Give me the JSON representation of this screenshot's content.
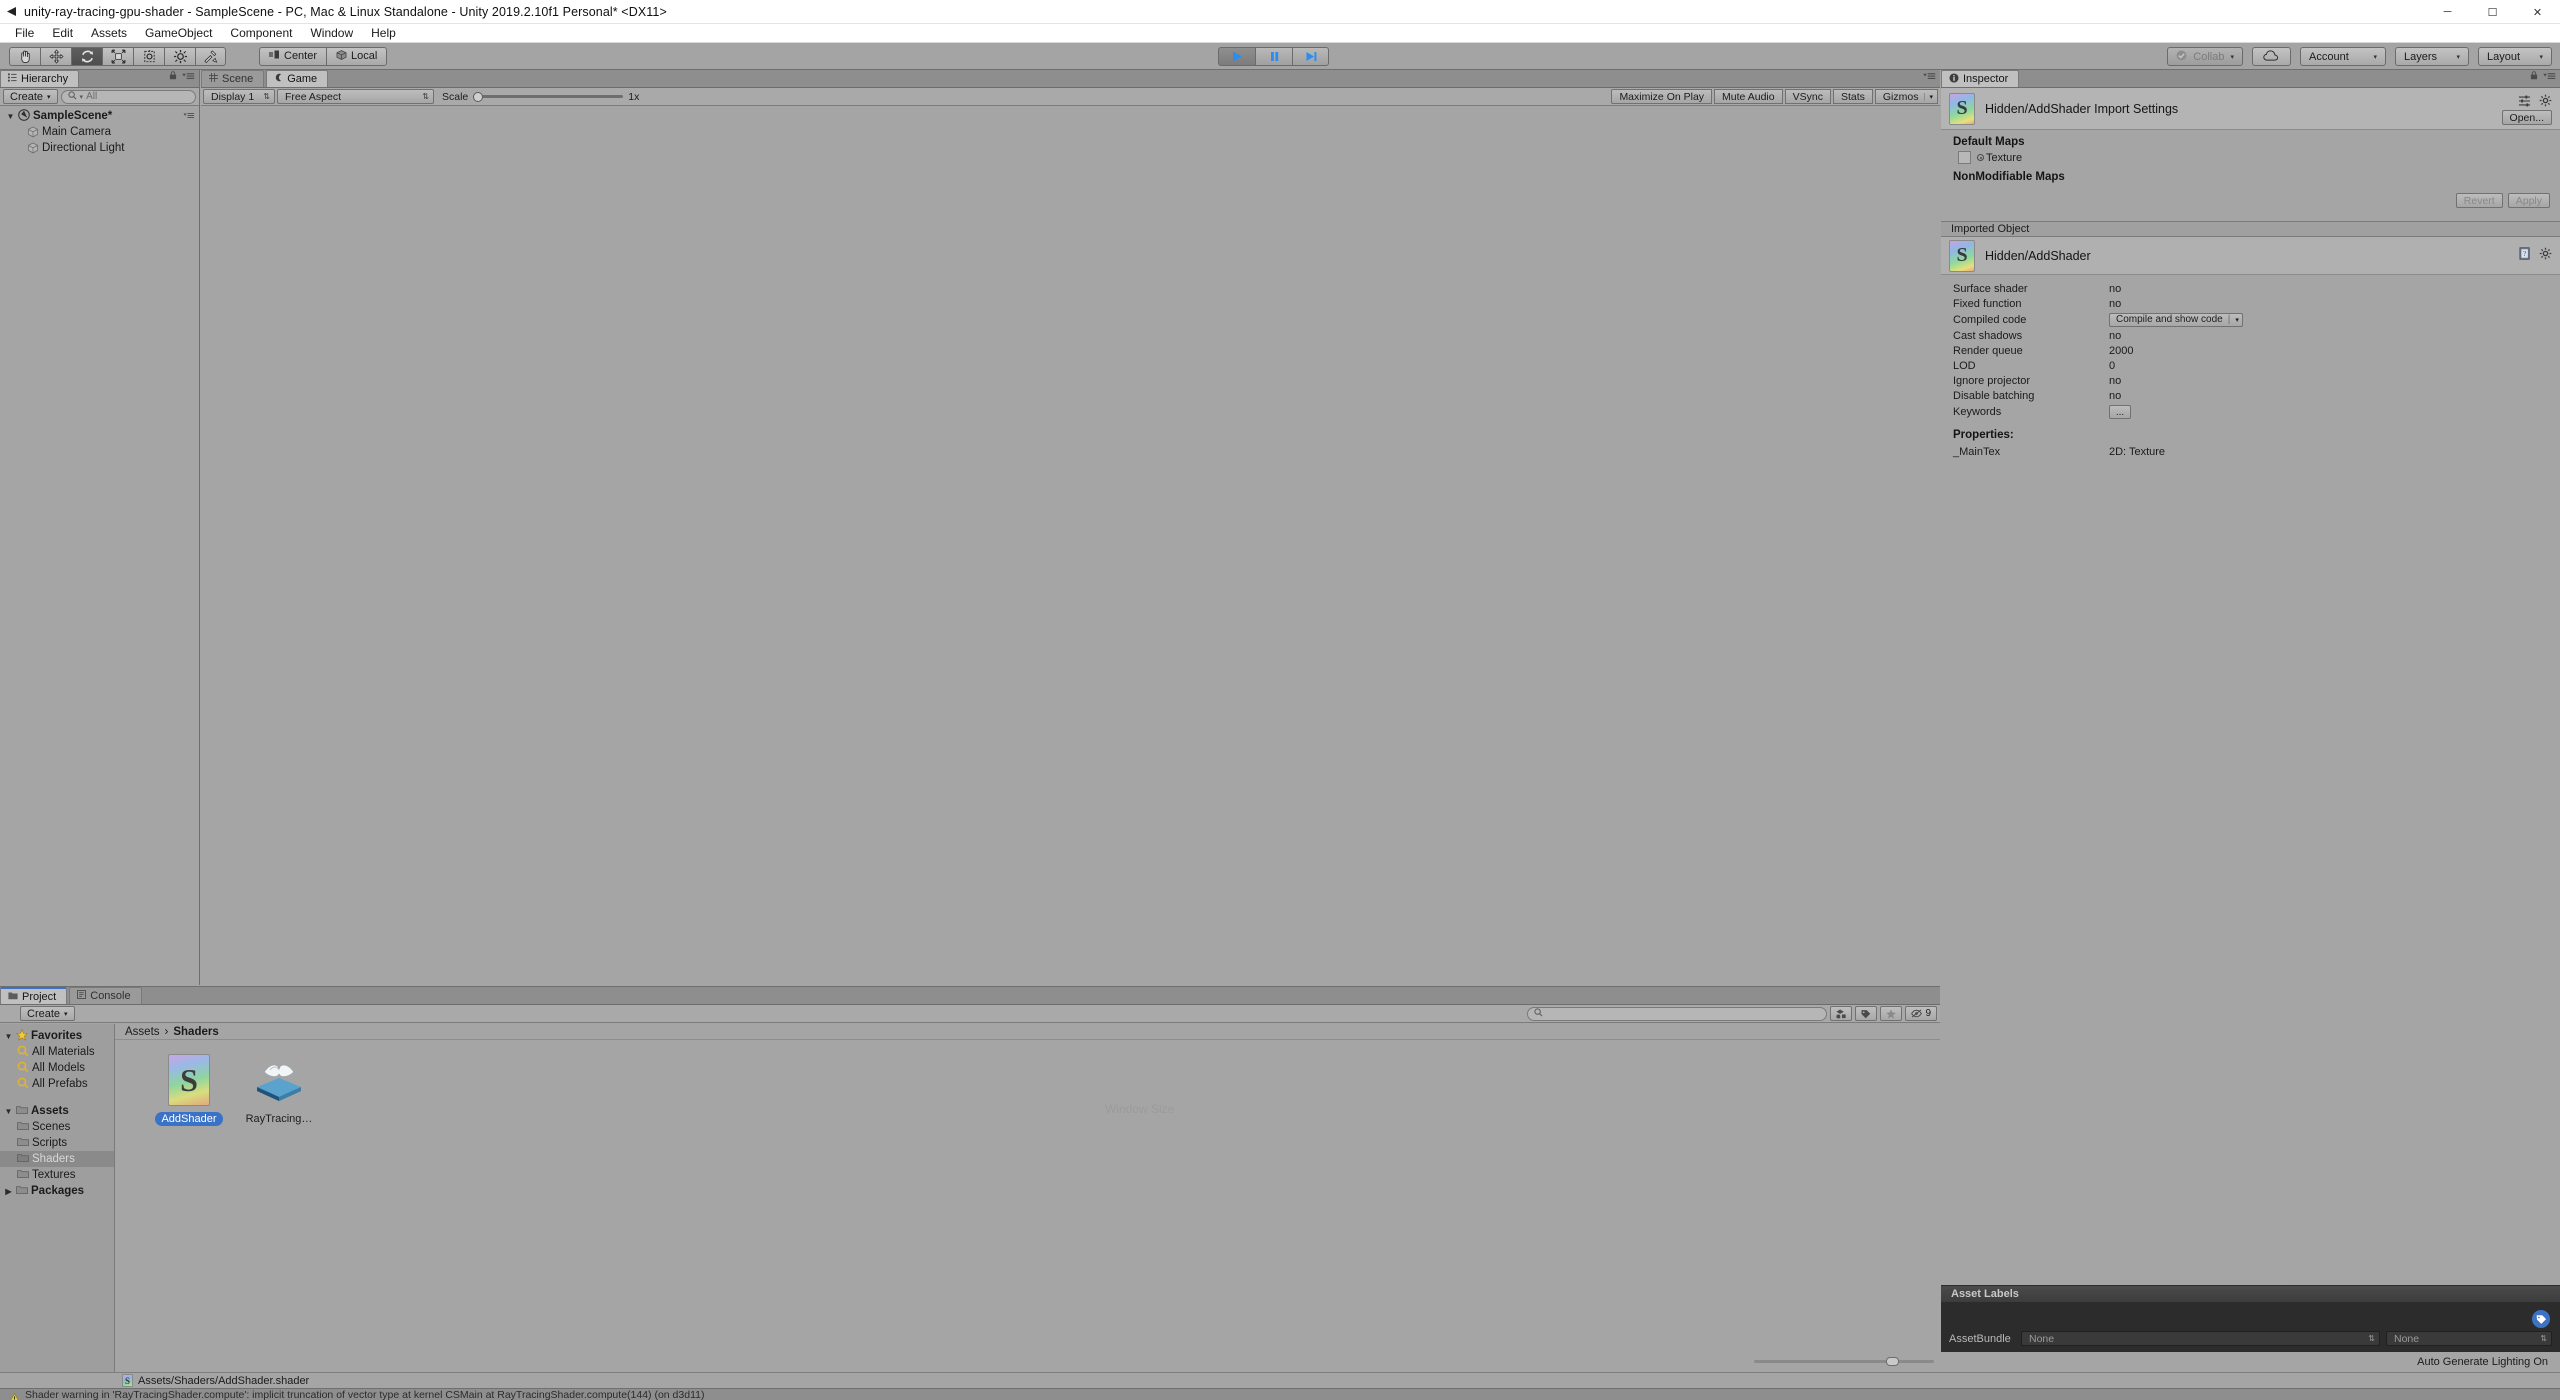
{
  "window": {
    "title": "unity-ray-tracing-gpu-shader - SampleScene - PC, Mac & Linux Standalone - Unity 2019.2.10f1 Personal* <DX11>",
    "app_icon": "unity-logo-icon",
    "minimize": "─",
    "maximize": "☐",
    "close": "✕"
  },
  "menu": {
    "items": [
      "File",
      "Edit",
      "Assets",
      "GameObject",
      "Component",
      "Window",
      "Help"
    ]
  },
  "toolbar": {
    "tools": [
      {
        "name": "hand-tool",
        "active": false
      },
      {
        "name": "move-tool",
        "active": false
      },
      {
        "name": "rotate-tool",
        "active": true
      },
      {
        "name": "scale-tool",
        "active": false
      },
      {
        "name": "rect-tool",
        "active": false
      },
      {
        "name": "transform-tool",
        "active": false
      },
      {
        "name": "custom-editor-tool",
        "active": false
      }
    ],
    "pivot_label": "Center",
    "space_label": "Local",
    "play": "play-icon",
    "pause": "pause-icon",
    "step": "step-icon",
    "collab_label": "Collab",
    "cloud_label": "cloud-icon",
    "account_label": "Account",
    "layers_label": "Layers",
    "layout_label": "Layout",
    "caret": "▾"
  },
  "hierarchy": {
    "tab_label": "Hierarchy",
    "create_label": "Create",
    "search_placeholder": "All",
    "scene_name": "SampleScene*",
    "objects": [
      "Main Camera",
      "Directional Light"
    ]
  },
  "gameview": {
    "tabs": [
      {
        "label": "Scene",
        "active": false,
        "icon": "grid-icon"
      },
      {
        "label": "Game",
        "active": true,
        "icon": "gamepad-icon"
      }
    ],
    "display_label": "Display 1",
    "aspect_label": "Free Aspect",
    "scale_label": "Scale",
    "scale_value": "1x",
    "toggles": [
      "Maximize On Play",
      "Mute Audio",
      "VSync",
      "Stats",
      "Gizmos"
    ]
  },
  "project": {
    "tabs": [
      {
        "label": "Project",
        "active": true,
        "icon": "folder-icon"
      },
      {
        "label": "Console",
        "active": false,
        "icon": "console-icon"
      }
    ],
    "create_label": "Create",
    "search_placeholder": "",
    "filter_icons": [
      "asset-filter-icon",
      "label-filter-icon",
      "favorite-filter-icon",
      "hidden-filter-icon"
    ],
    "hidden_count": "9",
    "tree": [
      {
        "label": "Favorites",
        "depth": 0,
        "bold": true,
        "arrow": "▼",
        "icon": "star-icon",
        "selected": false
      },
      {
        "label": "All Materials",
        "depth": 1,
        "bold": false,
        "arrow": "",
        "icon": "search-icon",
        "selected": false
      },
      {
        "label": "All Models",
        "depth": 1,
        "bold": false,
        "arrow": "",
        "icon": "search-icon",
        "selected": false
      },
      {
        "label": "All Prefabs",
        "depth": 1,
        "bold": false,
        "arrow": "",
        "icon": "search-icon",
        "selected": false
      },
      {
        "label": "Assets",
        "depth": 0,
        "bold": true,
        "arrow": "▼",
        "icon": "folder-icon",
        "selected": false
      },
      {
        "label": "Scenes",
        "depth": 1,
        "bold": false,
        "arrow": "",
        "icon": "folder-icon",
        "selected": false
      },
      {
        "label": "Scripts",
        "depth": 1,
        "bold": false,
        "arrow": "",
        "icon": "folder-icon",
        "selected": false
      },
      {
        "label": "Shaders",
        "depth": 1,
        "bold": false,
        "arrow": "",
        "icon": "folder-icon",
        "selected": true
      },
      {
        "label": "Textures",
        "depth": 1,
        "bold": false,
        "arrow": "",
        "icon": "folder-icon",
        "selected": false
      },
      {
        "label": "Packages",
        "depth": 0,
        "bold": true,
        "arrow": "▶",
        "icon": "folder-icon",
        "selected": false
      }
    ],
    "breadcrumb": [
      "Assets",
      "Shaders"
    ],
    "breadcrumb_sep": "›",
    "assets": [
      {
        "label": "AddShader",
        "icon": "shader-asset-icon",
        "selected": true
      },
      {
        "label": "RayTracing…",
        "icon": "compute-shader-asset-icon",
        "selected": false
      }
    ],
    "watermark": "Window Size"
  },
  "inspector": {
    "tab_label": "Inspector",
    "import_title": "Hidden/AddShader Import Settings",
    "open_label": "Open...",
    "default_maps_label": "Default Maps",
    "texture_label": "Texture",
    "non_modifiable_label": "NonModifiable Maps",
    "revert_label": "Revert",
    "apply_label": "Apply",
    "imported_object_label": "Imported Object",
    "object_name": "Hidden/AddShader",
    "properties": [
      {
        "key": "Surface shader",
        "value": "no",
        "type": "text"
      },
      {
        "key": "Fixed function",
        "value": "no",
        "type": "text"
      },
      {
        "key": "Compiled code",
        "value": "Compile and show code",
        "type": "dropdown"
      },
      {
        "key": "Cast shadows",
        "value": "no",
        "type": "text"
      },
      {
        "key": "Render queue",
        "value": "2000",
        "type": "text"
      },
      {
        "key": "LOD",
        "value": "0",
        "type": "text"
      },
      {
        "key": "Ignore projector",
        "value": "no",
        "type": "text"
      },
      {
        "key": "Disable batching",
        "value": "no",
        "type": "text"
      },
      {
        "key": "Keywords",
        "value": "...",
        "type": "button"
      }
    ],
    "properties_heading": "Properties:",
    "shader_properties": [
      {
        "key": "_MainTex",
        "value": "2D: Texture"
      }
    ],
    "asset_labels_title": "Asset Labels",
    "assetbundle_label": "AssetBundle",
    "assetbundle_value": "None",
    "assetbundle_variant": "None"
  },
  "status": {
    "selected_path": "Assets/Shaders/AddShader.shader",
    "warning": "Shader warning in 'RayTracingShader.compute': implicit truncation of vector type at kernel CSMain at RayTracingShader.compute(144) (on d3d11)",
    "auto_lighting": "Auto Generate Lighting On"
  },
  "colors": {
    "accent_blue": "#3a72c8",
    "play_blue": "#2a8ef0",
    "ground_green": "#7bf07b",
    "warning_yellow": "#e8d44a",
    "panel_gray": "#a5a5a5"
  }
}
